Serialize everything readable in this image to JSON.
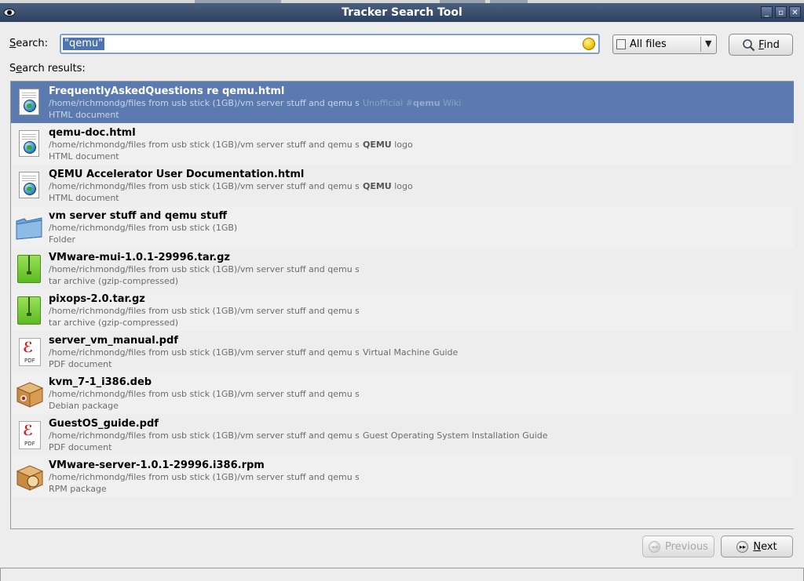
{
  "window": {
    "title": "Tracker Search Tool"
  },
  "search": {
    "label": "Search:",
    "value": "\"qemu\"",
    "filter": "All files",
    "find_label": "Find"
  },
  "results": {
    "label": "Search results:",
    "items": [
      {
        "name": "FrequentlyAskedQuestions re qemu.html",
        "path": "/home/richmondg/files from usb stick (1GB)/vm server stuff and qemu stuff",
        "type": "HTML document",
        "snippet_pre": "Unofficial #",
        "snippet_hl": "qemu",
        "snippet_post": " Wiki",
        "icon": "html-icon"
      },
      {
        "name": "qemu-doc.html",
        "path": "/home/richmondg/files from usb stick (1GB)/vm server stuff and qemu stuff",
        "type": "HTML document",
        "snippet_pre": "",
        "snippet_hl": "QEMU",
        "snippet_post": " logo",
        "icon": "html-icon"
      },
      {
        "name": "QEMU Accelerator User Documentation.html",
        "path": "/home/richmondg/files from usb stick (1GB)/vm server stuff and qemu stuff",
        "type": "HTML document",
        "snippet_pre": "",
        "snippet_hl": "QEMU",
        "snippet_post": " logo",
        "icon": "html-icon"
      },
      {
        "name": "vm server stuff and qemu stuff",
        "path": "/home/richmondg/files from usb stick (1GB)",
        "type": "Folder",
        "snippet_pre": "",
        "snippet_hl": "",
        "snippet_post": "",
        "icon": "folder-icon"
      },
      {
        "name": "VMware-mui-1.0.1-29996.tar.gz",
        "path": "/home/richmondg/files from usb stick (1GB)/vm server stuff and qemu stuff",
        "type": "tar archive (gzip-compressed)",
        "snippet_pre": "",
        "snippet_hl": "",
        "snippet_post": "",
        "icon": "archive-icon"
      },
      {
        "name": "pixops-2.0.tar.gz",
        "path": "/home/richmondg/files from usb stick (1GB)/vm server stuff and qemu stuff",
        "type": "tar archive (gzip-compressed)",
        "snippet_pre": "",
        "snippet_hl": "",
        "snippet_post": "",
        "icon": "archive-icon"
      },
      {
        "name": "server_vm_manual.pdf",
        "path": "/home/richmondg/files from usb stick (1GB)/vm server stuff and qemu stuff",
        "type": "PDF document",
        "snippet_pre": "Virtual Machine Guide",
        "snippet_hl": "",
        "snippet_post": "",
        "icon": "pdf-icon"
      },
      {
        "name": "kvm_7-1_i386.deb",
        "path": "/home/richmondg/files from usb stick (1GB)/vm server stuff and qemu stuff",
        "type": "Debian package",
        "snippet_pre": "",
        "snippet_hl": "",
        "snippet_post": "",
        "icon": "deb-package-icon"
      },
      {
        "name": "GuestOS_guide.pdf",
        "path": "/home/richmondg/files from usb stick (1GB)/vm server stuff and qemu stuff",
        "type": "PDF document",
        "snippet_pre": "Guest Operating System Installation Guide",
        "snippet_hl": "",
        "snippet_post": "",
        "icon": "pdf-icon"
      },
      {
        "name": "VMware-server-1.0.1-29996.i386.rpm",
        "path": "/home/richmondg/files from usb stick (1GB)/vm server stuff and qemu stuff",
        "type": "RPM package",
        "snippet_pre": "",
        "snippet_hl": "",
        "snippet_post": "",
        "icon": "rpm-package-icon"
      }
    ]
  },
  "pager": {
    "previous_label": "Previous",
    "next_label": "Next"
  },
  "colors": {
    "selection": "#5b7bb0",
    "titlebar": "#3a4e70"
  }
}
